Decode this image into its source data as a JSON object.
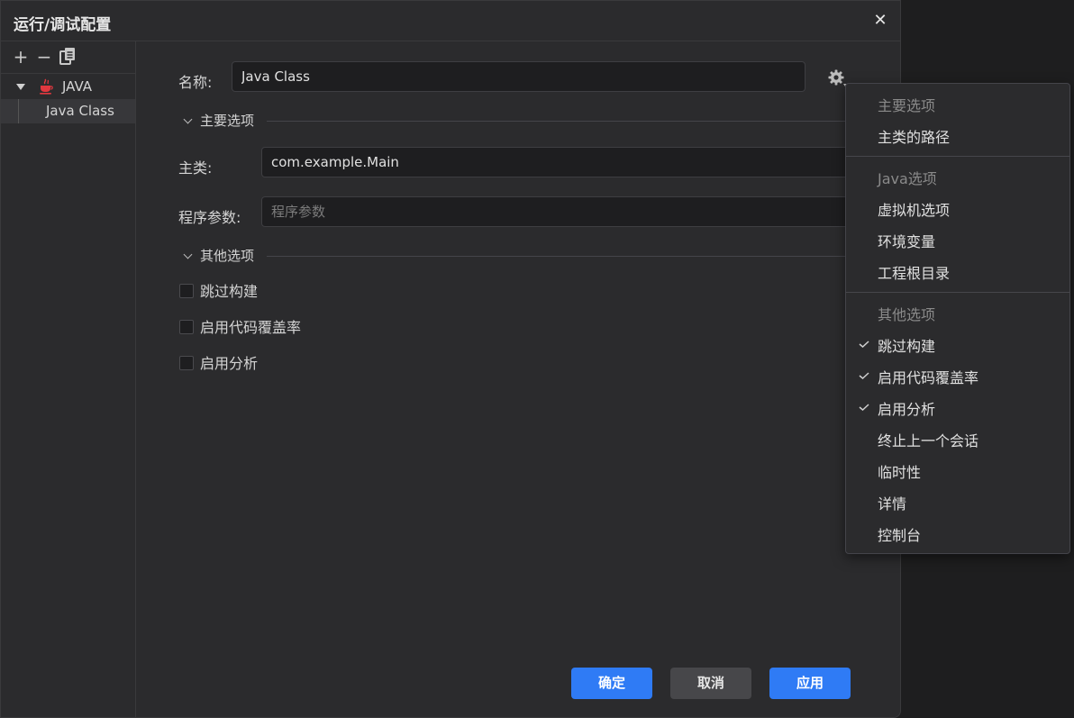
{
  "dialog": {
    "title": "运行/调试配置"
  },
  "sidebar": {
    "tree": [
      {
        "label": "JAVA",
        "icon": "java-cup-icon",
        "expanded": true
      },
      {
        "label": "Java Class",
        "selected": true
      }
    ]
  },
  "form": {
    "name_label": "名称:",
    "name_value": "Java Class",
    "section_main": "主要选项",
    "main_class_label": "主类:",
    "main_class_value": "com.example.Main",
    "program_args_label": "程序参数:",
    "program_args_placeholder": "程序参数",
    "section_other": "其他选项",
    "checks": [
      "跳过构建",
      "启用代码覆盖率",
      "启用分析"
    ]
  },
  "buttons": {
    "ok": "确定",
    "cancel": "取消",
    "apply": "应用"
  },
  "dropdown": {
    "header_main": "主要选项",
    "main_path": "主类的路径",
    "header_java": "Java选项",
    "vm_options": "虚拟机选项",
    "env_vars": "环境变量",
    "project_root": "工程根目录",
    "header_other": "其他选项",
    "skip_build": "跳过构建",
    "enable_coverage": "启用代码覆盖率",
    "enable_profiling": "启用分析",
    "terminate_last": "终止上一个会话",
    "temporary": "临时性",
    "details": "详情",
    "console": "控制台"
  },
  "colors": {
    "accent": "#2f7bf5",
    "java_icon": "#e0383f"
  }
}
